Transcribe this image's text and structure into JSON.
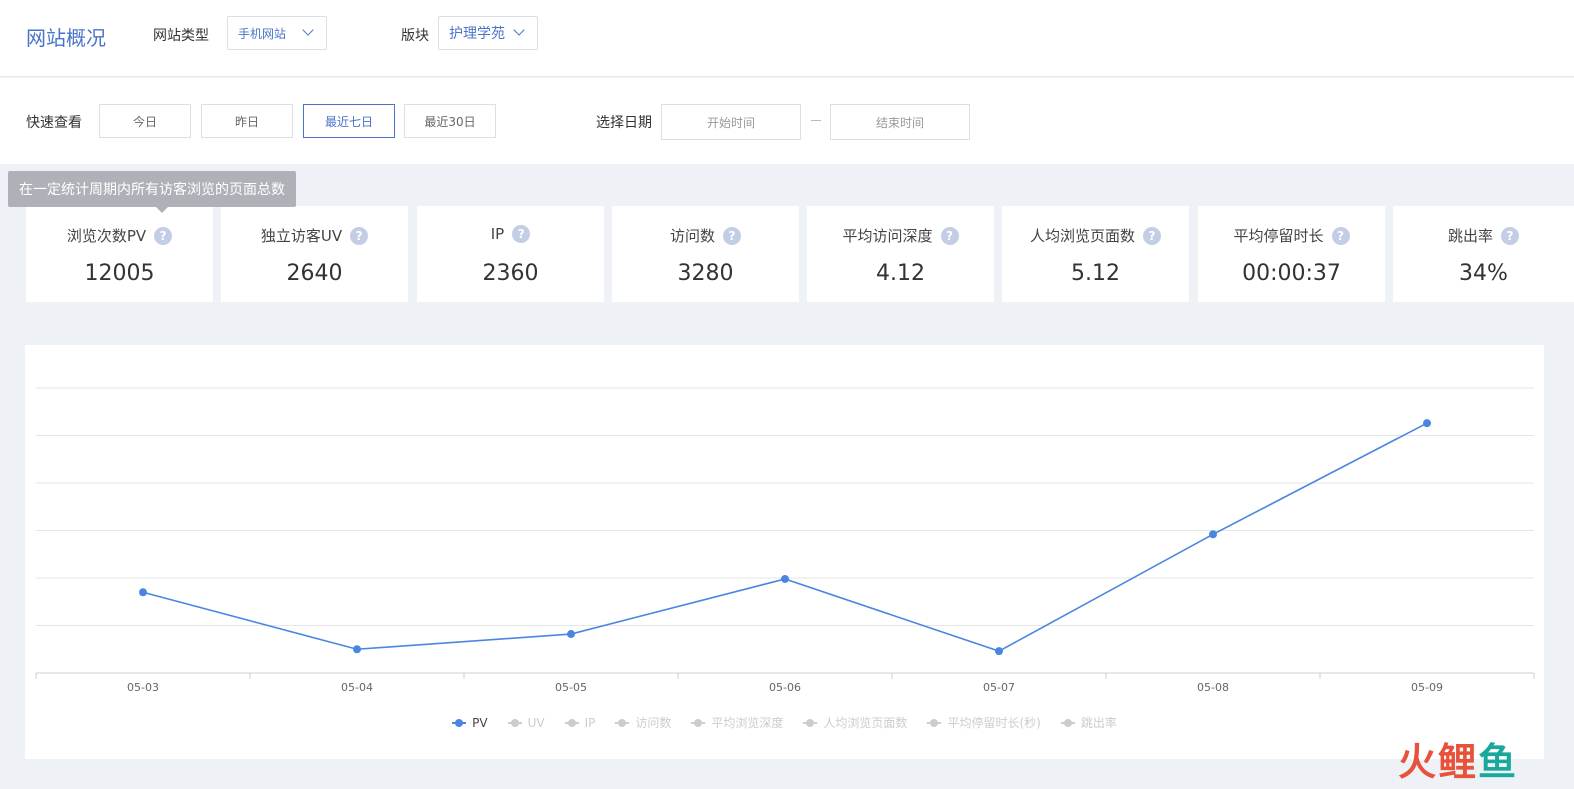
{
  "header": {
    "title": "网站概况",
    "site_type_label": "网站类型",
    "site_type_value": "手机网站",
    "section_label": "版块",
    "section_value": "护理学苑"
  },
  "filter": {
    "quick_label": "快速查看",
    "quick_options": [
      "今日",
      "昨日",
      "最近七日",
      "最近30日"
    ],
    "active_quick": "最近七日",
    "date_label": "选择日期",
    "start_placeholder": "开始时间",
    "end_placeholder": "结束时间"
  },
  "tooltip": "在一定统计周期内所有访客浏览的页面总数",
  "metrics": [
    {
      "label": "浏览次数PV",
      "value": "12005"
    },
    {
      "label": "独立访客UV",
      "value": "2640"
    },
    {
      "label": "IP",
      "value": "2360"
    },
    {
      "label": "访问数",
      "value": "3280"
    },
    {
      "label": "平均访问深度",
      "value": "4.12"
    },
    {
      "label": "人均浏览页面数",
      "value": "5.12"
    },
    {
      "label": "平均停留时长",
      "value": "00:00:37"
    },
    {
      "label": "跳出率",
      "value": "34%"
    }
  ],
  "chart_data": {
    "type": "line",
    "title": "",
    "xlabel": "",
    "ylabel": "",
    "categories": [
      "05-03",
      "05-04",
      "05-05",
      "05-06",
      "05-07",
      "05-08",
      "05-09"
    ],
    "series": [
      {
        "name": "PV",
        "values": [
          1700,
          500,
          820,
          1980,
          460,
          2920,
          5260
        ],
        "color": "#4a86e0",
        "visible": true
      }
    ],
    "ylim": [
      0,
      6000
    ],
    "grid": true,
    "legend": [
      "PV",
      "UV",
      "IP",
      "访问数",
      "平均浏览深度",
      "人均浏览页面数",
      "平均停留时长(秒)",
      "跳出率"
    ],
    "legend_active": "PV",
    "legend_position": "bottom"
  },
  "watermark": {
    "text": "火鲤鱼"
  },
  "colors": {
    "accent": "#4a74c9",
    "line": "#4a86e0",
    "inactive": "#cccccc"
  }
}
